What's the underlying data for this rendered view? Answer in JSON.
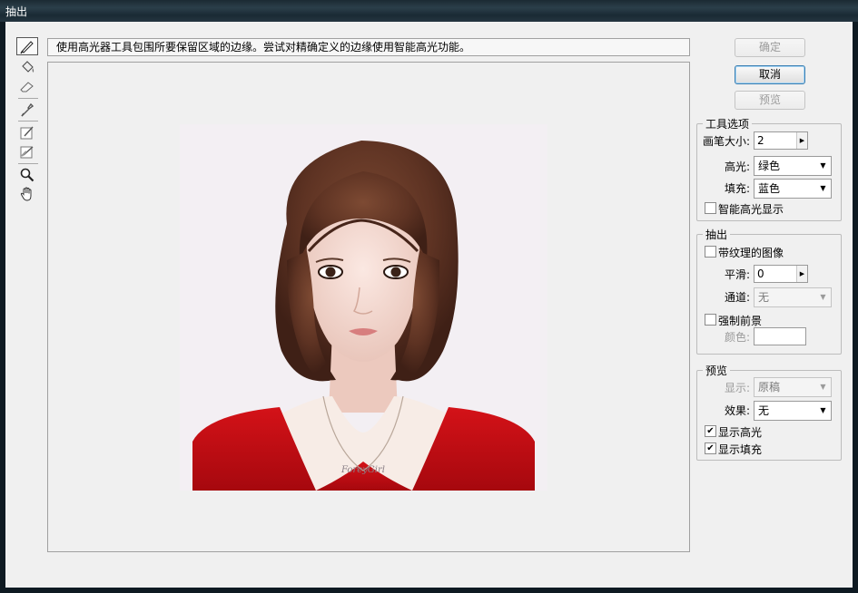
{
  "window": {
    "title": "抽出"
  },
  "hint": "使用高光器工具包围所要保留区域的边缘。尝试对精确定义的边缘使用智能高光功能。",
  "tools": [
    {
      "icon": "edge-highlighter-icon",
      "active": true
    },
    {
      "icon": "fill-bucket-icon"
    },
    {
      "icon": "eraser-icon"
    },
    {
      "icon": "eyedropper-icon"
    },
    {
      "icon": "cleanup-tool-icon"
    },
    {
      "icon": "edge-touchup-tool-icon"
    },
    {
      "icon": "zoom-icon"
    },
    {
      "icon": "hand-icon"
    }
  ],
  "buttons": {
    "ok": "确定",
    "cancel": "取消",
    "preview": "预览"
  },
  "tool_options": {
    "legend": "工具选项",
    "brush_size_label": "画笔大小:",
    "brush_size": "2",
    "highlight_label": "高光:",
    "highlight_value": "绿色",
    "fill_label": "填充:",
    "fill_value": "蓝色",
    "smart_highlight_label": "智能高光显示",
    "smart_highlight_checked": false
  },
  "extraction": {
    "legend": "抽出",
    "textured_label": "带纹理的图像",
    "textured_checked": false,
    "smooth_label": "平滑:",
    "smooth_value": "0",
    "channel_label": "通道:",
    "channel_value": "无",
    "force_fg_label": "强制前景",
    "force_fg_checked": false,
    "color_label": "颜色:"
  },
  "preview": {
    "legend": "预览",
    "show_label": "显示:",
    "show_value": "原稿",
    "effect_label": "效果:",
    "effect_value": "无",
    "show_highlight_label": "显示高光",
    "show_highlight_checked": true,
    "show_fill_label": "显示填充",
    "show_fill_checked": true
  },
  "photo": {
    "necklace_text": "ForeyGirl"
  }
}
